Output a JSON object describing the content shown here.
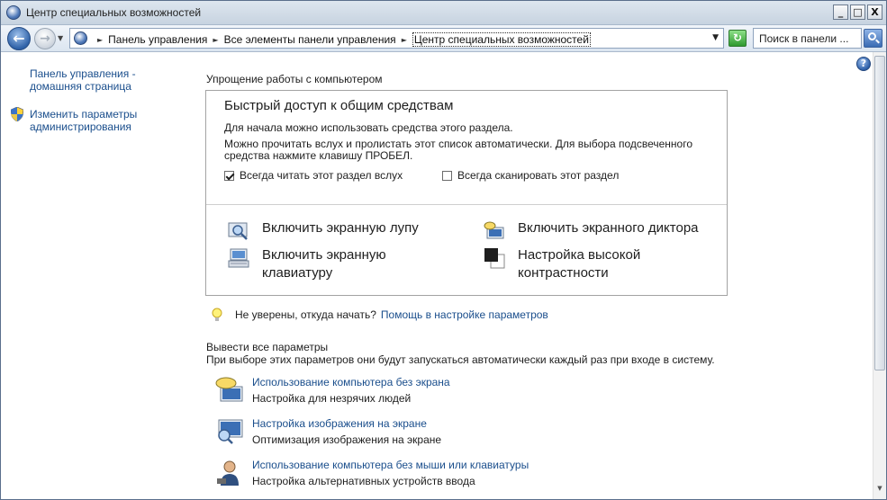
{
  "window": {
    "title": "Центр специальных возможностей",
    "controls": {
      "minimize": "_",
      "maximize": "□",
      "close": "X"
    }
  },
  "address_bar": {
    "breadcrumbs": [
      "Панель управления",
      "Все элементы панели управления",
      "Центр специальных возможностей"
    ],
    "search_placeholder": "Поиск в панели ..."
  },
  "left_pane": {
    "links": [
      {
        "label": "Панель управления - домашняя страница"
      },
      {
        "label": "Изменить параметры администрирования",
        "icon": "shield-icon"
      }
    ]
  },
  "main": {
    "section_title": "Упрощение работы с компьютером",
    "quick_access": {
      "title": "Быстрый доступ к общим средствам",
      "line1": "Для начала можно использовать средства этого раздела.",
      "line2": "Можно прочитать вслух и пролистать этот список автоматически. Для выбора подсвеченного средства нажмите клавишу ПРОБЕЛ.",
      "checkbox_read": {
        "label": "Всегда читать этот раздел вслух",
        "checked": true
      },
      "checkbox_scan": {
        "label": "Всегда сканировать этот раздел",
        "checked": false
      },
      "tools": [
        {
          "label": "Включить экранную лупу",
          "icon": "magnifier-icon"
        },
        {
          "label": "Включить экранного диктора",
          "icon": "narrator-icon"
        },
        {
          "label": "Включить экранную клавиатуру",
          "icon": "keyboard-icon"
        },
        {
          "label": "Настройка высокой контрастности",
          "icon": "contrast-icon"
        }
      ]
    },
    "tip": {
      "text": "Не уверены, откуда начать?",
      "link": "Помощь в настройке параметров"
    },
    "explore": {
      "title": "Вывести все параметры",
      "description": "При выборе этих параметров они будут запускаться автоматически каждый раз при входе в систему.",
      "items": [
        {
          "link": "Использование компьютера без экрана",
          "description": "Настройка для незрячих людей",
          "icon": "speech-monitor-icon"
        },
        {
          "link": "Настройка изображения на экране",
          "description": "Оптимизация изображения на экране",
          "icon": "screen-magnify-icon"
        },
        {
          "link": "Использование компьютера без мыши или клавиатуры",
          "description": "Настройка альтернативных устройств ввода",
          "icon": "user-input-icon"
        }
      ]
    }
  },
  "colors": {
    "link": "#1a4e8c",
    "accent": "#2f62a8"
  }
}
